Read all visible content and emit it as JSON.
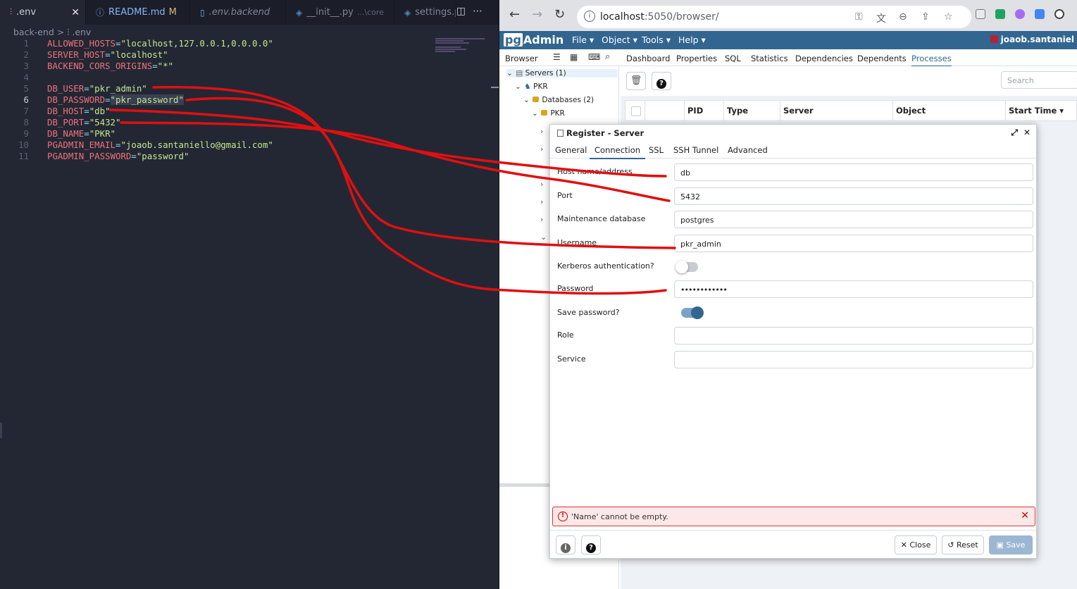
{
  "vscode": {
    "tabs": [
      {
        "icon": "⫶",
        "label": ".env",
        "close": "✕"
      },
      {
        "icon": "ⓘ",
        "label": "README.md",
        "flag": "M"
      },
      {
        "icon": "▯",
        "label": ".env.backend"
      },
      {
        "icon": "◈",
        "label": "__init__.py",
        "dim": "...\\core"
      },
      {
        "icon": "◈",
        "label": "settings.py"
      }
    ],
    "breadcrumb": {
      "folder": "back-end",
      "sep": ">",
      "file": ".env"
    },
    "lines": [
      {
        "n": "1",
        "key": "ALLOWED_HOSTS",
        "val": "\"localhost,127.0.0.1,0.0.0.0\""
      },
      {
        "n": "2",
        "key": "SERVER_HOST",
        "val": "\"localhost\""
      },
      {
        "n": "3",
        "key": "BACKEND_CORS_ORIGINS",
        "val": "\"*\""
      },
      {
        "n": "4",
        "key": "",
        "val": ""
      },
      {
        "n": "5",
        "key": "DB_USER",
        "val": "\"pkr_admin\""
      },
      {
        "n": "6",
        "key": "DB_PASSWORD",
        "val": "\"pkr_password\""
      },
      {
        "n": "7",
        "key": "DB_HOST",
        "val": "\"db\""
      },
      {
        "n": "8",
        "key": "DB_PORT",
        "val": "\"5432\""
      },
      {
        "n": "9",
        "key": "DB_NAME",
        "val": "\"PKR\""
      },
      {
        "n": "10",
        "key": "PGADMIN_EMAIL",
        "val": "\"joaob.santaniello@gmail.com\""
      },
      {
        "n": "11",
        "key": "PGADMIN_PASSWORD",
        "val": "\"password\""
      }
    ],
    "current_line": "6",
    "colors": {
      "bg": "#232734",
      "key": "#f07178",
      "string": "#c3e88d"
    }
  },
  "chrome": {
    "url_host": "localhost",
    "url_rest": ":5050/browser/"
  },
  "pgadmin": {
    "logo_pg": "pg",
    "logo_text": "Admin",
    "menus": [
      "File ▾",
      "Object ▾",
      "Tools ▾",
      "Help ▾"
    ],
    "user": "joaob.santaniel",
    "panel_tabs": [
      "Browser",
      "Dashboard",
      "Properties",
      "SQL",
      "Statistics",
      "Dependencies",
      "Dependents",
      "Processes"
    ],
    "active_panel_tab": "Processes",
    "tree": {
      "servers": "Servers (1)",
      "server": "PKR",
      "databases": "Databases (2)",
      "db": "PKR"
    },
    "search_placeholder": "Search",
    "grid_columns": [
      "",
      "",
      "PID",
      "Type",
      "Server",
      "Object",
      "Start Time ▾"
    ],
    "dialog": {
      "title": "Register - Server",
      "tabs": [
        "General",
        "Connection",
        "SSL",
        "SSH Tunnel",
        "Advanced"
      ],
      "active_tab": "Connection",
      "fields": {
        "host_label": "Host name/address",
        "host_value": "db",
        "port_label": "Port",
        "port_value": "5432",
        "maintdb_label": "Maintenance database",
        "maintdb_value": "postgres",
        "username_label": "Username",
        "username_value": "pkr_admin",
        "kerberos_label": "Kerberos authentication?",
        "kerberos_on": false,
        "password_label": "Password",
        "password_value": "••••••••••••",
        "savepw_label": "Save password?",
        "savepw_on": true,
        "role_label": "Role",
        "role_value": "",
        "service_label": "Service",
        "service_value": ""
      },
      "error": "'Name' cannot be empty.",
      "buttons": {
        "close": "Close",
        "reset": "Reset",
        "save": "Save"
      }
    },
    "colors": {
      "brand": "#326690",
      "error_bg": "#fce8e8",
      "error_border": "#dd3333",
      "annotation": "#e01010"
    }
  }
}
